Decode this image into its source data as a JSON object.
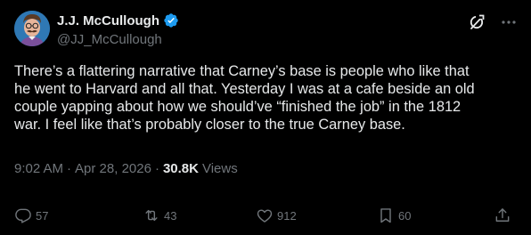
{
  "author": {
    "display_name": "J.J. McCullough",
    "handle": "@JJ_McCullough",
    "verified": true,
    "verified_color": "#1d9bf0"
  },
  "tweet": {
    "text": "There’s a flattering narrative that Carney’s base is people who like that\nhe went to Harvard and all that. Yesterday I was at a cafe beside an old\ncouple yapping about how we should’ve “finished the job” in the 1812\nwar. I feel like that’s probably closer to the true Carney base.",
    "time": "9:02 AM",
    "separator_1": "·",
    "date": "Apr 28, 2026",
    "separator_2": "·",
    "views_count": "30.8K",
    "views_label": "Views"
  },
  "actions": {
    "replies": "57",
    "reposts": "43",
    "likes": "912",
    "bookmarks": "60"
  },
  "icons": {
    "top": [
      "grok-icon",
      "more-icon"
    ],
    "actions": [
      "reply-icon",
      "repost-icon",
      "like-icon",
      "bookmark-icon",
      "share-icon"
    ]
  },
  "colors": {
    "background": "#000000",
    "text_primary": "#e7e9ea",
    "text_secondary": "#71767b"
  }
}
